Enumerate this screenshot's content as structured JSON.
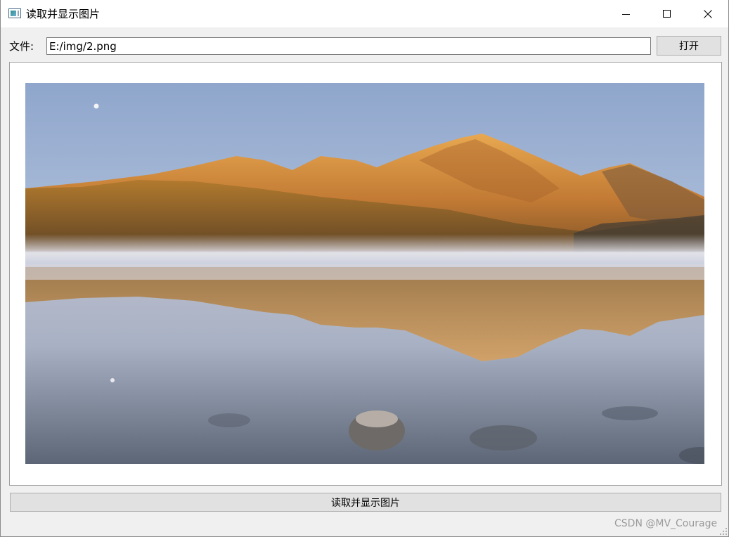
{
  "window": {
    "title": "读取并显示图片",
    "minimize_icon": "minimize-icon",
    "maximize_icon": "maximize-icon",
    "close_icon": "close-icon"
  },
  "file_row": {
    "label": "文件:",
    "path_value": "E:/img/2.png",
    "open_label": "打开"
  },
  "image_view": {
    "content": "mountain-lake-photo"
  },
  "actions": {
    "read_label": "读取并显示图片"
  },
  "watermark": "CSDN @MV_Courage",
  "colors": {
    "titlebar": "#ffffff",
    "window_bg": "#f0f0f0",
    "button_bg": "#e1e1e1",
    "frame_border": "#a0a0a0"
  }
}
